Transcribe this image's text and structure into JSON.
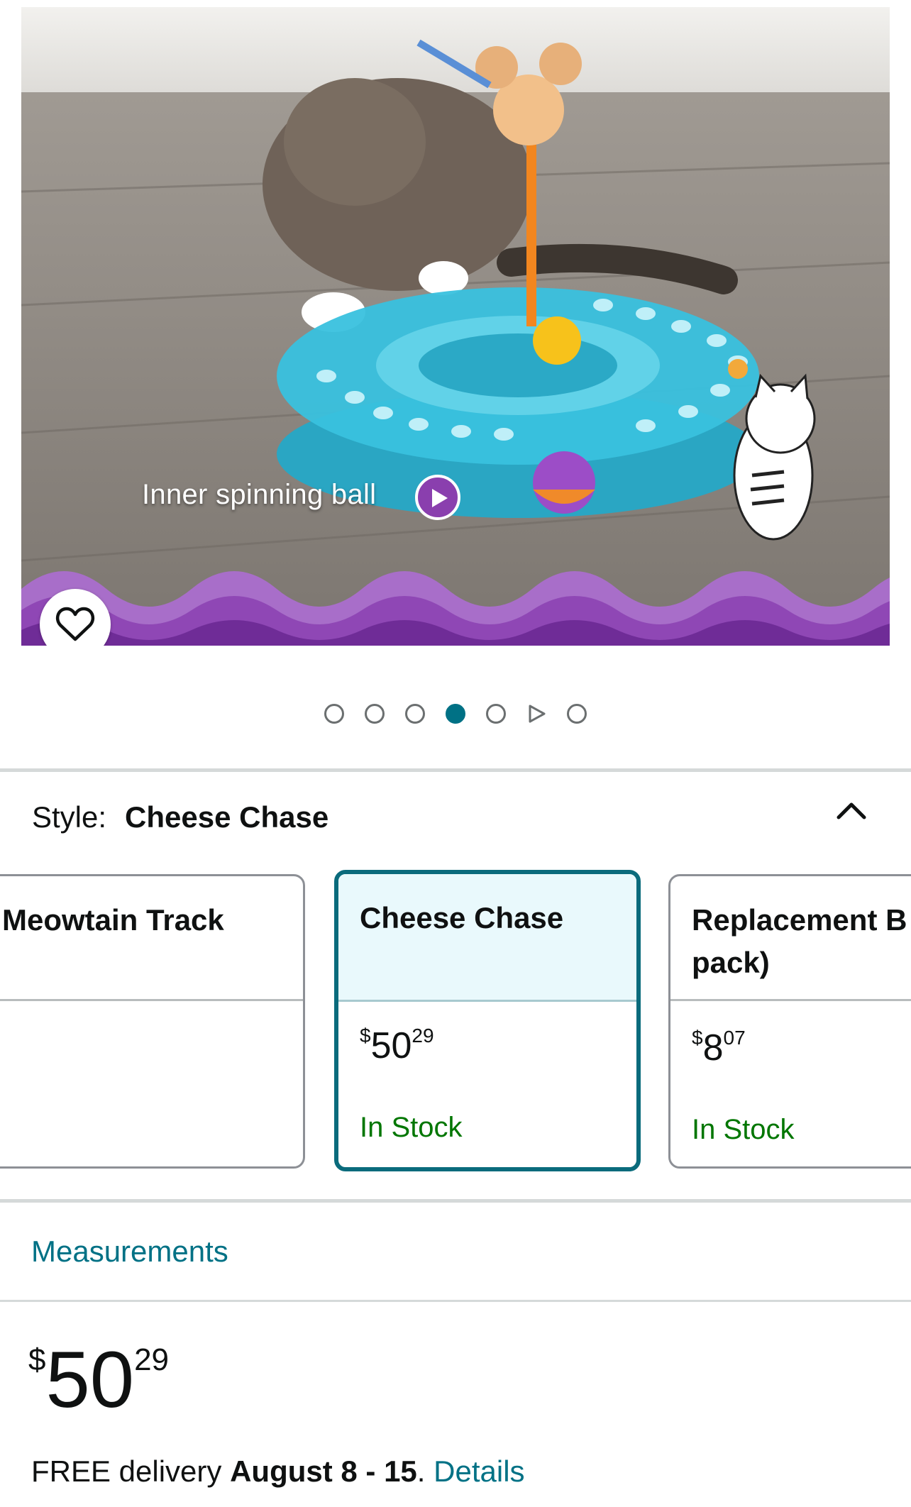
{
  "hero": {
    "caption": "Inner spinning ball",
    "wishlist_icon": "heart-outline-icon",
    "play_icon": "play-icon"
  },
  "carousel": {
    "total_indicators": 7,
    "active_index": 3,
    "video_index": 5
  },
  "style": {
    "label": "Style:",
    "selected": "Cheese Chase",
    "toggle_icon": "chevron-up-icon",
    "options": [
      {
        "name": "Meowtain Track",
        "price_currency": "",
        "price_whole": "",
        "price_fraction": "",
        "stock": ""
      },
      {
        "name": "Cheese Chase",
        "price_currency": "$",
        "price_whole": "50",
        "price_fraction": "29",
        "stock": "In Stock"
      },
      {
        "name": "Replacement B pack)",
        "price_currency": "$",
        "price_whole": "8",
        "price_fraction": "07",
        "stock": "In Stock"
      }
    ]
  },
  "measurements_link": "Measurements",
  "price": {
    "currency": "$",
    "whole": "50",
    "fraction": "29"
  },
  "delivery": {
    "prefix": "FREE delivery ",
    "dates": "August 8 - 15",
    "separator": ". ",
    "details_link": "Details"
  },
  "colors": {
    "accent_teal": "#007185",
    "selected_border": "#0a6b7c",
    "in_stock": "#007600",
    "wave_purple": "#8a3fae"
  }
}
